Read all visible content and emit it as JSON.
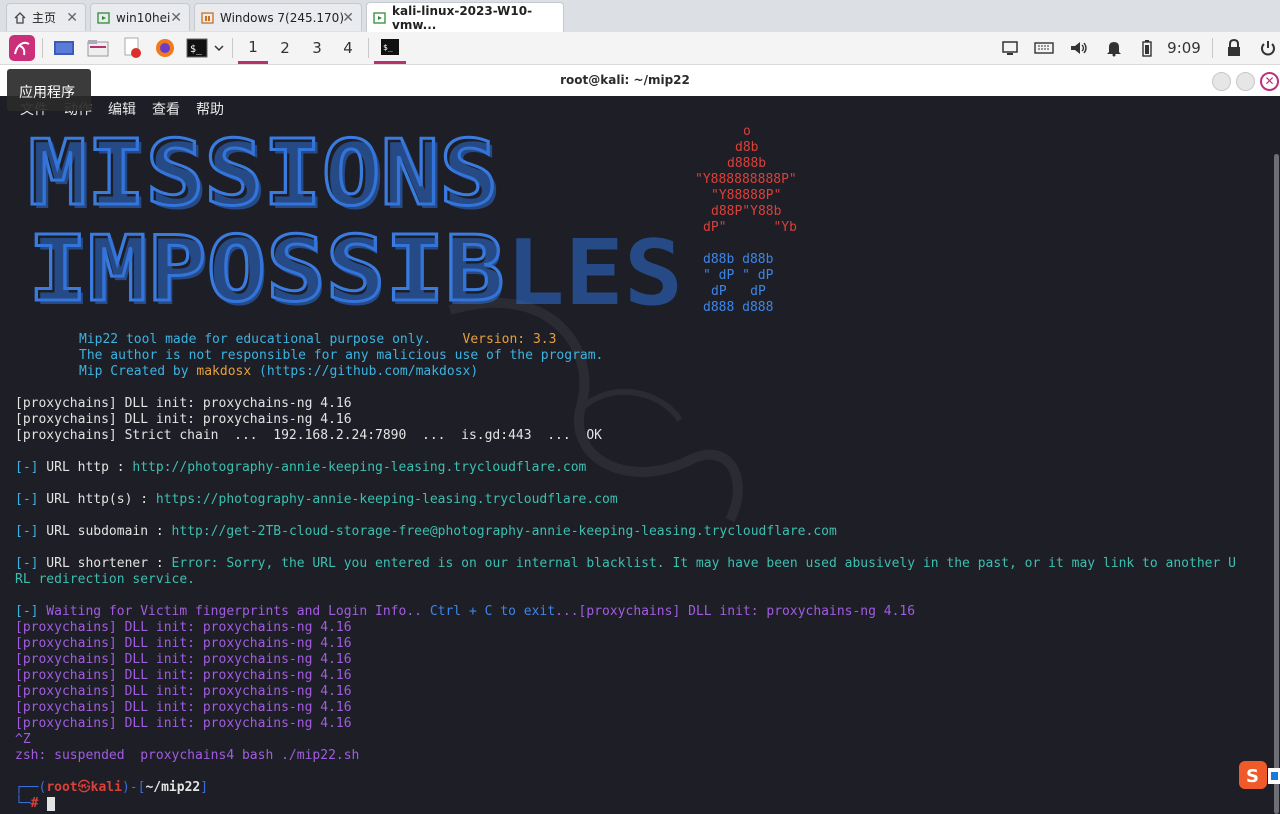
{
  "browser_tabs": [
    {
      "label": "主页",
      "icon": "home-icon"
    },
    {
      "label": "win10hei",
      "icon": "vm-icon"
    },
    {
      "label": "Windows 7(245.170)",
      "icon": "vm-icon"
    },
    {
      "label": "kali-linux-2023-W10-vmw...",
      "icon": "vm-icon"
    }
  ],
  "panel": {
    "workspaces": [
      "1",
      "2",
      "3",
      "4"
    ],
    "clock": "9:09"
  },
  "window": {
    "title": "root@kali: ~/mip22",
    "tooltip": "应用程序"
  },
  "menu": [
    "文件",
    "动作",
    "编辑",
    "查看",
    "帮助"
  ],
  "banner": {
    "line1": "MISSIONS",
    "line2": "IMPOSSIBLES",
    "red_art": [
      "o",
      "d8b",
      "d888b",
      "\"Y888888888P\"",
      "\"Y88888P\"",
      "d88P\"Y88b",
      "dP\"      \"Yb"
    ],
    "blue_art": [
      "d88b d88b",
      "\" dP \" dP",
      "dP   dP",
      "d888 d888"
    ]
  },
  "info": {
    "line1_text": "Mip22 tool made for educational purpose only.",
    "version": "Version: 3.3",
    "line2": "The author is not responsible for any malicious use of the program.",
    "line3_prefix": "Mip Created by ",
    "author": "makdosx",
    "line3_url": " (https://github.com/makdosx)"
  },
  "proxy": [
    "[proxychains] DLL init: proxychains-ng 4.16",
    "[proxychains] DLL init: proxychains-ng 4.16",
    "[proxychains] Strict chain  ...  192.168.2.24:7890  ...  is.gd:443  ...  OK"
  ],
  "urls": [
    {
      "marker": "[-]",
      "label": " URL http : ",
      "value": "http://photography-annie-keeping-leasing.trycloudflare.com"
    },
    {
      "marker": "[-]",
      "label": " URL http(s) : ",
      "value": "https://photography-annie-keeping-leasing.trycloudflare.com"
    },
    {
      "marker": "[-]",
      "label": " URL subdomain : ",
      "value": "http://get-2TB-cloud-storage-free@photography-annie-keeping-leasing.trycloudflare.com"
    }
  ],
  "shortener": {
    "marker": "[-]",
    "label": " URL shortener : ",
    "error1": "Error: Sorry, the URL you entered is on our internal blacklist. It may have been used abusively in the past, or it may link to another U",
    "error2": "RL redirection service."
  },
  "waiting": {
    "marker": "[-]",
    "text": " Waiting for Victim fingerprints and Login Info.. ",
    "ctrl": "Ctrl + C to exit",
    "tail": "...[proxychains] DLL init: proxychains-ng 4.16"
  },
  "proxy_repeat": [
    "[proxychains] DLL init: proxychains-ng 4.16",
    "[proxychains] DLL init: proxychains-ng 4.16",
    "[proxychains] DLL init: proxychains-ng 4.16",
    "[proxychains] DLL init: proxychains-ng 4.16",
    "[proxychains] DLL init: proxychains-ng 4.16",
    "[proxychains] DLL init: proxychains-ng 4.16",
    "[proxychains] DLL init: proxychains-ng 4.16"
  ],
  "ctrlz": "^Z",
  "suspended": "zsh: suspended  proxychains4 bash ./mip22.sh",
  "prompt": {
    "open": "┌──(",
    "user": "root",
    "at": "㉿",
    "host": "kali",
    "mid": ")-[",
    "path": "~/mip22",
    "close": "]",
    "line2": "└─",
    "hash": "#"
  },
  "colors": {
    "accent": "#b8306e",
    "term_bg": "#1d1e26",
    "banner_blue": "#3a7be0"
  }
}
